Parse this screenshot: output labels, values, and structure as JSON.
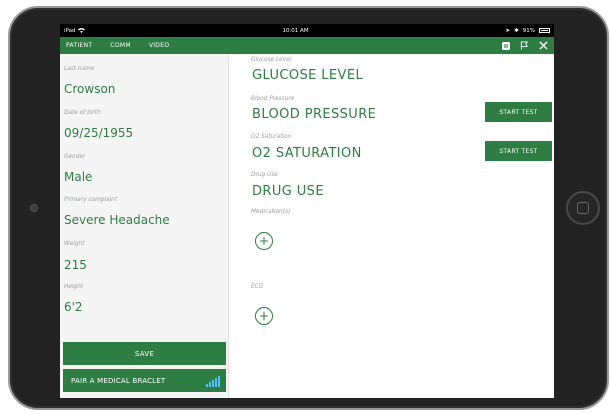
{
  "status": {
    "device": "iPad",
    "time": "10:01 AM",
    "battery": "91%"
  },
  "nav": {
    "tabs": [
      "PATIENT",
      "COMM",
      "VIDEO"
    ]
  },
  "patient": {
    "last_name_label": "Last name",
    "last_name": "Crowson",
    "dob_label": "Date of birth",
    "dob": "09/25/1955",
    "gender_label": "Gender",
    "gender": "Male",
    "complaint_label": "Primary complaint",
    "complaint": "Severe Headache",
    "weight_label": "Weight",
    "weight": "215",
    "height_label": "Height",
    "height": "6'2",
    "save_label": "SAVE",
    "pair_label": "PAIR A MEDICAL BRACLET"
  },
  "tests": {
    "glucose_label": "Glucose Level",
    "glucose_value": "GLUCOSE LEVEL",
    "bp_label": "Blood Pressure",
    "bp_value": "BLOOD PRESSURE",
    "o2_label": "O2 Saturation",
    "o2_value": "O2 SATURATION",
    "drug_label": "Drug Use",
    "drug_value": "DRUG USE",
    "med_label": "Medication(s)",
    "ecg_label": "ECG",
    "start_test_label": "START TEST"
  },
  "colors": {
    "brand_green": "#2e7d43",
    "signal_blue": "#4fc3f7"
  },
  "icons": [
    "wifi-icon",
    "pause-icon",
    "flag-icon",
    "close-icon",
    "plus-icon",
    "signal-bars-icon"
  ]
}
